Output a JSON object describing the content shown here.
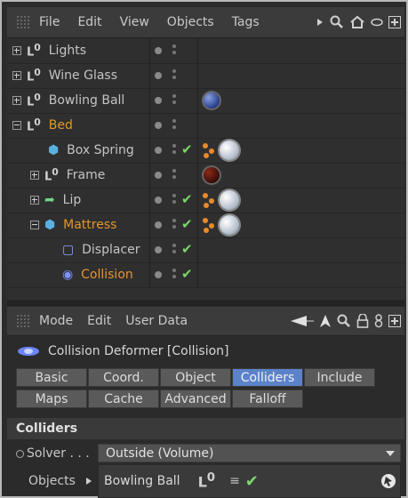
{
  "object_manager": {
    "menu": [
      "File",
      "Edit",
      "View",
      "Objects",
      "Tags"
    ],
    "rows": [
      {
        "name": "Lights",
        "type": "null",
        "expand": "plus",
        "indent": 0,
        "color": "normal",
        "tags": [],
        "check": false
      },
      {
        "name": "Wine Glass",
        "type": "null",
        "expand": "plus",
        "indent": 0,
        "color": "normal",
        "tags": [],
        "check": false
      },
      {
        "name": "Bowling Ball",
        "type": "null",
        "expand": "plus",
        "indent": 0,
        "color": "normal",
        "tags": [
          "blue-material"
        ],
        "check": false
      },
      {
        "name": "Bed",
        "type": "null",
        "expand": "minus",
        "indent": 0,
        "color": "orange",
        "tags": [],
        "check": false
      },
      {
        "name": "Box Spring",
        "type": "cube",
        "expand": "none",
        "indent": 1,
        "color": "normal",
        "tags": [
          "dynamics-body",
          "white-material"
        ],
        "check": true
      },
      {
        "name": "Frame",
        "type": "null",
        "expand": "plus",
        "indent": 1,
        "color": "normal",
        "tags": [
          "dark-material"
        ],
        "check": false
      },
      {
        "name": "Lip",
        "type": "capsule",
        "expand": "plus",
        "indent": 1,
        "color": "normal",
        "tags": [
          "dynamics-body",
          "white-material"
        ],
        "check": true
      },
      {
        "name": "Mattress",
        "type": "cube",
        "expand": "minus",
        "indent": 1,
        "color": "orange",
        "tags": [
          "dynamics-body",
          "white-material"
        ],
        "check": true
      },
      {
        "name": "Displacer",
        "type": "deformer",
        "expand": "none",
        "indent": 2,
        "color": "normal",
        "tags": [],
        "check": true
      },
      {
        "name": "Collision",
        "type": "collision",
        "expand": "none",
        "indent": 2,
        "color": "orange",
        "tags": [],
        "check": true
      }
    ]
  },
  "attributes": {
    "menu": [
      "Mode",
      "Edit",
      "User Data"
    ],
    "title": "Collision Deformer [Collision]",
    "tabs_row1": [
      "Basic",
      "Coord.",
      "Object",
      "Colliders",
      "Include"
    ],
    "tabs_row2": [
      "Maps",
      "Cache",
      "Advanced",
      "Falloff"
    ],
    "active_tab": "Colliders",
    "section": "Colliders",
    "solver_label": "Solver . . .",
    "solver_value": "Outside (Volume)",
    "objects_label": "Objects",
    "objects_item": "Bowling Ball"
  },
  "colors": {
    "accent": "#5c82c9",
    "active_name": "#e5942e",
    "check": "#7dd66b"
  }
}
